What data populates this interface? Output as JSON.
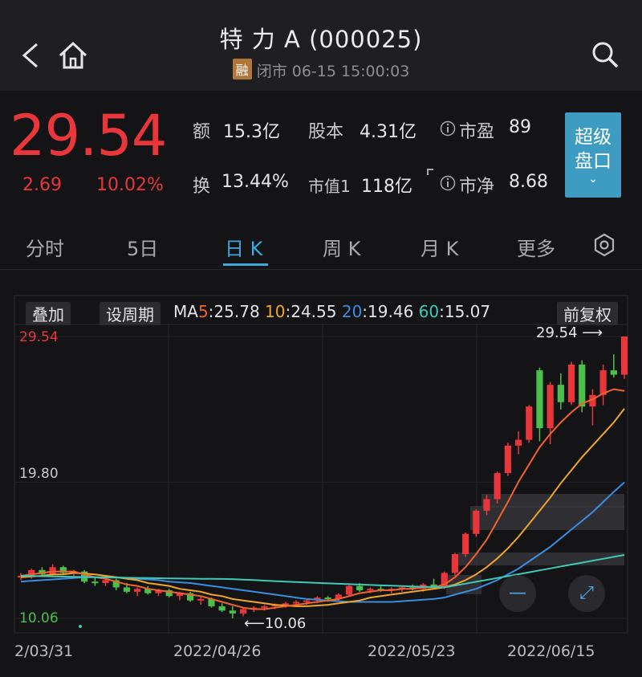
{
  "header": {
    "title": "特 力 A (000025)",
    "badge": "融",
    "status": "闭市 06-15 15:00:03"
  },
  "quote": {
    "price": "29.54",
    "change": "2.69",
    "change_pct": "10.02%",
    "fields": [
      {
        "label": "额",
        "value": "15.3亿"
      },
      {
        "label": "股本",
        "value": "4.31亿"
      },
      {
        "label": "市盈",
        "value": "89"
      },
      {
        "label": "换",
        "value": "13.44%"
      },
      {
        "label": "市值1",
        "value": "118亿"
      },
      {
        "label": "市净",
        "value": "8.68"
      }
    ],
    "super_button": {
      "line1": "超级",
      "line2": "盘口"
    }
  },
  "tabs": [
    "分时",
    "5日",
    "日 K",
    "周 K",
    "月 K",
    "更多"
  ],
  "active_tab": "日 K",
  "chart_toolbar": {
    "overlay": "叠加",
    "period": "设周期",
    "ma_prefix": "MA",
    "ma": [
      {
        "n": "5",
        "v": ":25.78",
        "color": "#f0622e"
      },
      {
        "n": "10",
        "v": ":24.55",
        "color": "#f0a52b"
      },
      {
        "n": "20",
        "v": ":19.46",
        "color": "#3a8de0"
      },
      {
        "n": "60",
        "v": ":15.07",
        "color": "#3fc9b6"
      }
    ],
    "adjust": "前复权"
  },
  "chart_data": {
    "type": "candlestick",
    "y_labels": [
      "29.54",
      "19.80",
      "10.06"
    ],
    "ylim": [
      10.06,
      29.54
    ],
    "max_annotation": "29.54",
    "min_annotation": "10.06",
    "x_labels": [
      "2/03/31",
      "2022/04/26",
      "2022/05/23",
      "2022/06/15"
    ],
    "colors": {
      "up": "#e8363a",
      "down": "#4cc04c",
      "ma5": "#f0622e",
      "ma10": "#f0a52b",
      "ma20": "#3a8de0",
      "ma60": "#3fc9b6"
    },
    "candles": [
      [
        12.9,
        13.2,
        12.7,
        13.0
      ],
      [
        13.0,
        13.5,
        12.8,
        13.4
      ],
      [
        13.4,
        13.6,
        13.0,
        13.1
      ],
      [
        13.1,
        13.8,
        13.0,
        13.6
      ],
      [
        13.6,
        13.7,
        13.1,
        13.2
      ],
      [
        13.2,
        13.4,
        12.9,
        13.3
      ],
      [
        13.3,
        13.4,
        12.5,
        12.6
      ],
      [
        12.6,
        12.9,
        12.3,
        12.5
      ],
      [
        12.5,
        12.8,
        12.3,
        12.7
      ],
      [
        12.7,
        12.8,
        12.0,
        12.2
      ],
      [
        12.2,
        12.5,
        11.8,
        11.9
      ],
      [
        11.9,
        12.2,
        11.6,
        12.1
      ],
      [
        12.1,
        12.3,
        11.7,
        11.8
      ],
      [
        11.8,
        12.1,
        11.6,
        12.0
      ],
      [
        12.0,
        12.1,
        11.5,
        11.6
      ],
      [
        11.6,
        11.9,
        11.3,
        11.8
      ],
      [
        11.8,
        11.9,
        11.2,
        11.3
      ],
      [
        11.3,
        11.6,
        11.0,
        11.4
      ],
      [
        11.4,
        11.5,
        10.8,
        10.9
      ],
      [
        10.9,
        11.1,
        10.5,
        10.6
      ],
      [
        10.6,
        10.9,
        10.06,
        10.4
      ],
      [
        10.4,
        10.8,
        10.2,
        10.7
      ],
      [
        10.7,
        10.9,
        10.5,
        10.8
      ],
      [
        10.8,
        11.0,
        10.6,
        10.9
      ],
      [
        10.9,
        11.1,
        10.7,
        11.0
      ],
      [
        11.0,
        11.2,
        10.8,
        11.1
      ],
      [
        11.1,
        11.3,
        10.9,
        11.2
      ],
      [
        11.2,
        11.4,
        11.0,
        11.3
      ],
      [
        11.3,
        11.6,
        11.1,
        11.5
      ],
      [
        11.5,
        11.6,
        11.2,
        11.4
      ],
      [
        11.4,
        11.8,
        11.3,
        11.7
      ],
      [
        11.7,
        12.4,
        11.6,
        12.3
      ],
      [
        12.3,
        12.5,
        11.9,
        12.0
      ],
      [
        12.0,
        12.2,
        11.8,
        12.1
      ],
      [
        12.1,
        12.3,
        11.9,
        12.0
      ],
      [
        12.0,
        12.2,
        11.8,
        12.1
      ],
      [
        12.1,
        12.3,
        11.9,
        12.2
      ],
      [
        12.2,
        12.4,
        12.0,
        12.1
      ],
      [
        12.1,
        12.5,
        11.9,
        12.4
      ],
      [
        12.4,
        12.8,
        12.1,
        12.2
      ],
      [
        12.2,
        13.3,
        12.1,
        13.2
      ],
      [
        13.2,
        14.6,
        13.0,
        14.5
      ],
      [
        14.5,
        16.0,
        14.3,
        15.9
      ],
      [
        15.9,
        17.6,
        15.7,
        17.5
      ],
      [
        17.5,
        18.6,
        17.2,
        18.3
      ],
      [
        18.3,
        20.2,
        18.0,
        20.1
      ],
      [
        20.1,
        22.2,
        19.9,
        22.0
      ],
      [
        22.0,
        23.0,
        21.4,
        22.4
      ],
      [
        22.4,
        24.8,
        22.2,
        24.7
      ],
      [
        27.2,
        27.4,
        22.3,
        23.2
      ],
      [
        23.2,
        26.4,
        22.1,
        26.2
      ],
      [
        26.2,
        27.0,
        24.5,
        25.0
      ],
      [
        25.0,
        27.8,
        24.8,
        27.6
      ],
      [
        27.6,
        27.9,
        24.3,
        24.7
      ],
      [
        24.7,
        25.9,
        23.4,
        25.5
      ],
      [
        25.5,
        27.6,
        24.8,
        27.2
      ],
      [
        27.2,
        28.3,
        26.7,
        26.9
      ],
      [
        26.9,
        29.54,
        26.6,
        29.54
      ]
    ],
    "ma5": [
      13.0,
      13.1,
      13.2,
      13.3,
      13.3,
      13.3,
      13.1,
      12.9,
      12.8,
      12.6,
      12.4,
      12.3,
      12.1,
      12.0,
      11.9,
      11.8,
      11.7,
      11.6,
      11.4,
      11.2,
      11.0,
      10.8,
      10.7,
      10.7,
      10.8,
      10.9,
      11.0,
      11.1,
      11.2,
      11.3,
      11.4,
      11.6,
      11.8,
      11.9,
      12.0,
      12.0,
      12.1,
      12.1,
      12.2,
      12.2,
      12.4,
      12.9,
      13.6,
      14.5,
      15.5,
      16.8,
      18.1,
      19.5,
      20.7,
      21.9,
      22.8,
      23.6,
      24.3,
      24.9,
      25.2,
      25.6,
      25.9,
      25.78
    ],
    "ma10": [
      12.9,
      12.95,
      13.0,
      13.1,
      13.1,
      13.2,
      13.15,
      13.1,
      13.0,
      12.9,
      12.8,
      12.7,
      12.5,
      12.4,
      12.3,
      12.1,
      12.0,
      11.9,
      11.7,
      11.6,
      11.4,
      11.3,
      11.2,
      11.1,
      11.0,
      10.95,
      10.9,
      10.9,
      10.95,
      11.0,
      11.1,
      11.2,
      11.3,
      11.5,
      11.6,
      11.7,
      11.8,
      11.9,
      12.0,
      12.1,
      12.2,
      12.4,
      12.7,
      13.1,
      13.6,
      14.2,
      14.9,
      15.7,
      16.6,
      17.5,
      18.4,
      19.4,
      20.3,
      21.2,
      22.0,
      22.8,
      23.6,
      24.55
    ],
    "ma20": [
      12.6,
      12.65,
      12.7,
      12.75,
      12.8,
      12.85,
      12.9,
      12.9,
      12.9,
      12.9,
      12.85,
      12.8,
      12.75,
      12.7,
      12.6,
      12.55,
      12.5,
      12.4,
      12.3,
      12.2,
      12.1,
      12.0,
      11.9,
      11.8,
      11.7,
      11.6,
      11.5,
      11.4,
      11.35,
      11.3,
      11.25,
      11.2,
      11.2,
      11.2,
      11.2,
      11.2,
      11.25,
      11.3,
      11.35,
      11.4,
      11.5,
      11.7,
      11.9,
      12.1,
      12.4,
      12.7,
      13.1,
      13.5,
      14.0,
      14.5,
      15.0,
      15.6,
      16.2,
      16.8,
      17.4,
      18.1,
      18.8,
      19.46
    ]
  },
  "chart_controls": {
    "minus": "—",
    "expand": "⤢"
  }
}
